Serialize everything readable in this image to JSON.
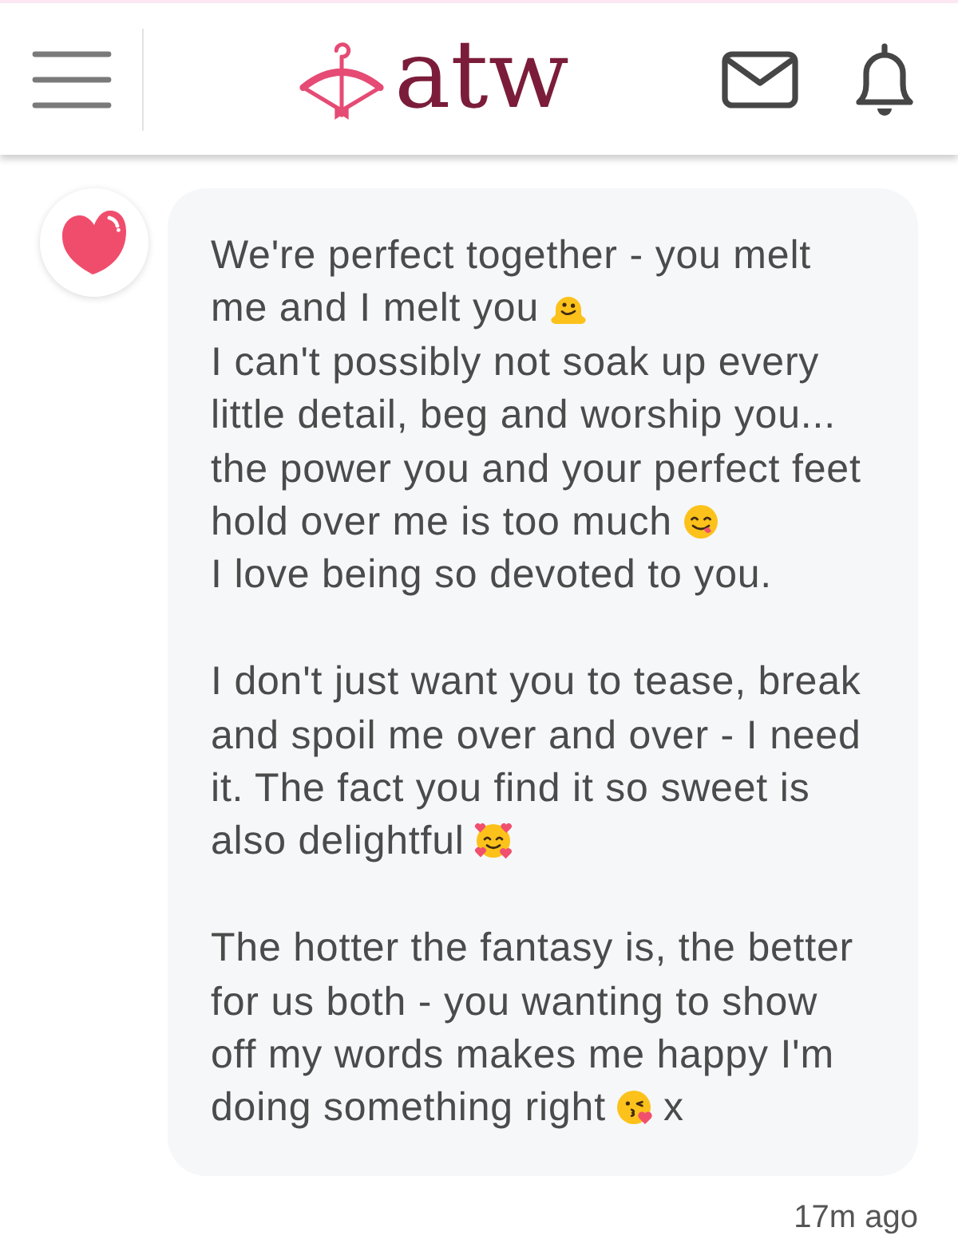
{
  "header": {
    "logo_text": "atw"
  },
  "message": {
    "paragraphs": [
      {
        "lines": [
          [
            {
              "kind": "text",
              "text": "We're perfect together - you melt"
            }
          ],
          [
            {
              "kind": "text",
              "text": "me and I melt you"
            },
            {
              "kind": "melting"
            }
          ],
          [
            {
              "kind": "text",
              "text": "I can't possibly not soak up every"
            }
          ],
          [
            {
              "kind": "text",
              "text": "little detail, beg and worship you..."
            }
          ],
          [
            {
              "kind": "text",
              "text": "the power you and your perfect feet"
            }
          ],
          [
            {
              "kind": "text",
              "text": "hold over me is too much"
            },
            {
              "kind": "savoring"
            }
          ],
          [
            {
              "kind": "text",
              "text": "I love being so devoted to you."
            }
          ]
        ]
      },
      {
        "lines": [
          [
            {
              "kind": "text",
              "text": "I don't just want you to tease, break"
            }
          ],
          [
            {
              "kind": "text",
              "text": "and spoil me over and over - I need"
            }
          ],
          [
            {
              "kind": "text",
              "text": "it. The fact you find it so sweet is"
            }
          ],
          [
            {
              "kind": "text",
              "text": "also delightful"
            },
            {
              "kind": "hearts"
            }
          ]
        ]
      },
      {
        "lines": [
          [
            {
              "kind": "text",
              "text": "The hotter the fantasy is, the better"
            }
          ],
          [
            {
              "kind": "text",
              "text": "for us both - you wanting to show"
            }
          ],
          [
            {
              "kind": "text",
              "text": "off my words makes me happy I'm"
            }
          ],
          [
            {
              "kind": "text",
              "text": "doing something right"
            },
            {
              "kind": "kiss"
            },
            {
              "kind": "text",
              "text": "x"
            }
          ]
        ]
      }
    ],
    "time": "17m ago"
  }
}
